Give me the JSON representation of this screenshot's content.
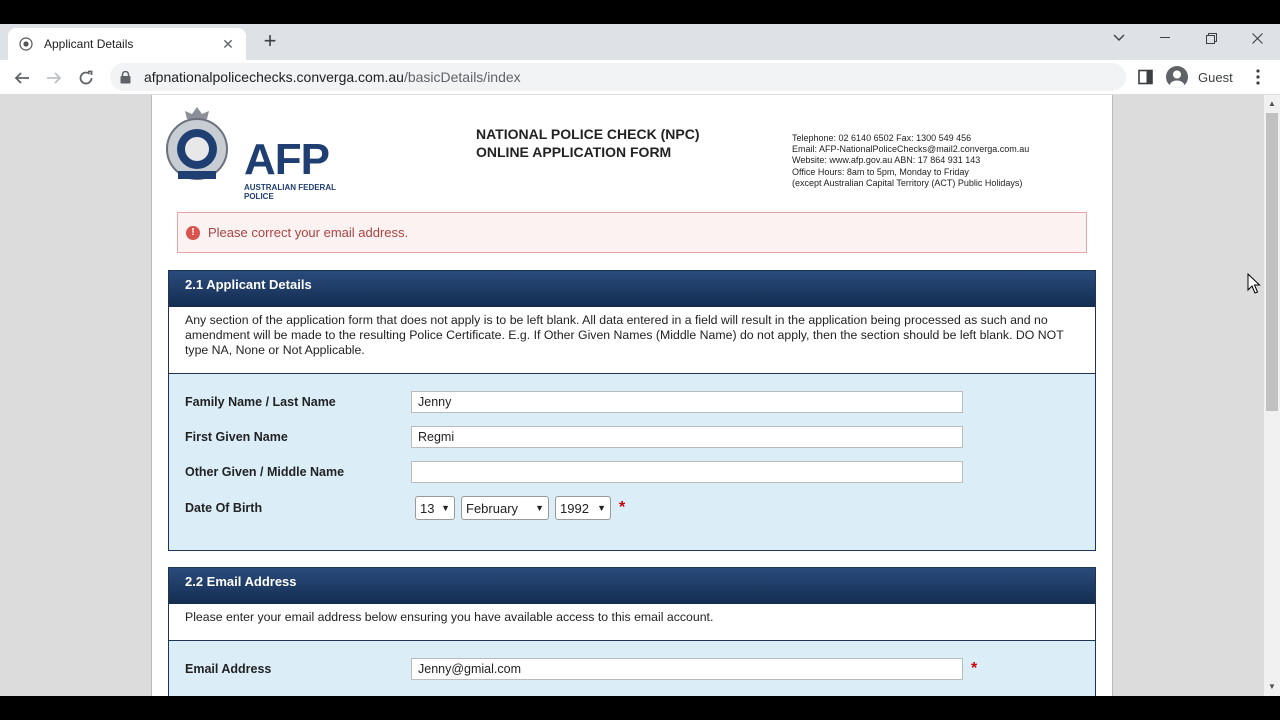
{
  "browser": {
    "tab_title": "Applicant Details",
    "url_host": "afpnationalpolicechecks.converga.com.au",
    "url_path": "/basicDetails/index",
    "profile_label": "Guest"
  },
  "header": {
    "logo_text": "AFP",
    "logo_subtext": "AUSTRALIAN FEDERAL POLICE",
    "title_line1": "NATIONAL POLICE CHECK (NPC)",
    "title_line2": "ONLINE APPLICATION FORM",
    "contact_line1": "Telephone: 02 6140 6502  Fax: 1300 549 456",
    "contact_line2": "Email: AFP-NationalPoliceChecks@mail2.converga.com.au",
    "contact_line3": "Website: www.afp.gov.au    ABN: 17 864 931 143",
    "contact_line4": "Office Hours: 8am to 5pm, Monday to Friday",
    "contact_line5": "(except Australian Capital Territory (ACT) Public Holidays)"
  },
  "alert": {
    "message": "Please correct your email address."
  },
  "applicant": {
    "heading": "2.1 Applicant Details",
    "note": "Any section of the application form that does not apply is to be left blank. All data entered in a field will result in the application being processed as such and no amendment will be made to the resulting Police Certificate. E.g. If Other Given Names (Middle Name) do not apply, then the section should be left blank. DO NOT type NA, None or Not Applicable.",
    "family_label": "Family Name / Last Name",
    "family_value": "Jenny",
    "first_label": "First Given Name",
    "first_value": "Regmi",
    "other_label": "Other Given / Middle Name",
    "other_value": "",
    "dob_label": "Date Of Birth",
    "dob_day": "13",
    "dob_month": "February",
    "dob_year": "1992",
    "required_mark": "*"
  },
  "email": {
    "heading": "2.2 Email Address",
    "note": "Please enter your email address below ensuring you have available access to this email account.",
    "email_label": "Email Address",
    "email_value": "Jenny@gmial.com",
    "required_mark": "*"
  },
  "colors": {
    "section_header": "#1f3f73",
    "form_body": "#dbeef8",
    "error_text": "#a94442"
  }
}
